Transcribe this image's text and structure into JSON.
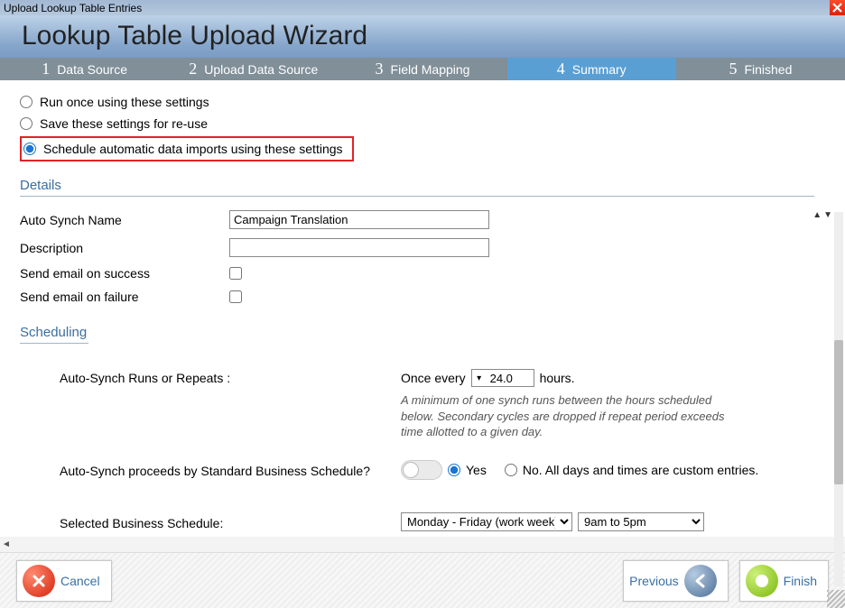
{
  "titlebar": {
    "title": "Upload Lookup Table Entries"
  },
  "banner": {
    "title": "Lookup Table Upload Wizard"
  },
  "steps": [
    {
      "num": "1",
      "label": "Data Source"
    },
    {
      "num": "2",
      "label": "Upload Data Source"
    },
    {
      "num": "3",
      "label": "Field Mapping"
    },
    {
      "num": "4",
      "label": "Summary"
    },
    {
      "num": "5",
      "label": "Finished"
    }
  ],
  "active_step_index": 3,
  "run_options": {
    "once": "Run once using these settings",
    "save": "Save these settings for re-use",
    "schedule": "Schedule automatic data imports using these settings",
    "selected": "schedule"
  },
  "sections": {
    "details": "Details",
    "scheduling": "Scheduling"
  },
  "details": {
    "auto_synch_name_label": "Auto Synch Name",
    "auto_synch_name_value": "Campaign Translation",
    "description_label": "Description",
    "description_value": "",
    "email_success_label": "Send email on success",
    "email_success_checked": false,
    "email_failure_label": "Send email on failure",
    "email_failure_checked": false
  },
  "scheduling": {
    "runs_label": "Auto-Synch Runs or Repeats :",
    "once_every": "Once every",
    "hours_value": "24.0",
    "hours_unit": "hours.",
    "hint": "A minimum of one synch runs between the hours scheduled below. Secondary cycles are dropped if repeat period exceeds time allotted to a given day.",
    "std_label": "Auto-Synch proceeds by Standard Business Schedule?",
    "yes": "Yes",
    "no_text": "No. All days and times are custom entries.",
    "std_selected": "yes",
    "sel_sched_label": "Selected Business Schedule:",
    "sched_days": "Monday - Friday (work week)",
    "sched_hours": "9am to 5pm"
  },
  "footer": {
    "cancel": "Cancel",
    "previous": "Previous",
    "finish": "Finish"
  }
}
